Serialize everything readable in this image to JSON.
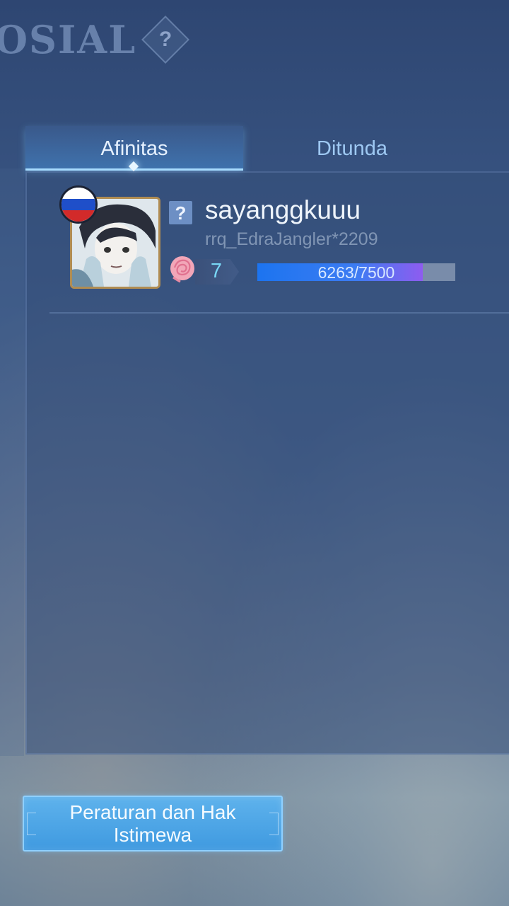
{
  "header": {
    "title": "OSIAL",
    "help_label": "?"
  },
  "tabs": [
    {
      "label": "Afinitas",
      "active": true
    },
    {
      "label": "Ditunda",
      "active": false
    }
  ],
  "friend": {
    "flag": "russia-flag",
    "badge_label": "?",
    "name": "sayanggkuuu",
    "id_text": "rrq_EdraJangler*2209",
    "level": "7",
    "progress_text": "6263/7500",
    "progress_value": 6263,
    "progress_max": 7500
  },
  "rules_button": {
    "label": "Peraturan dan Hak Istimewa"
  },
  "colors": {
    "accent": "#3f9ae0",
    "progress_start": "#1c74f0",
    "progress_end": "#8e5cf0",
    "level_text": "#79d8f6"
  }
}
